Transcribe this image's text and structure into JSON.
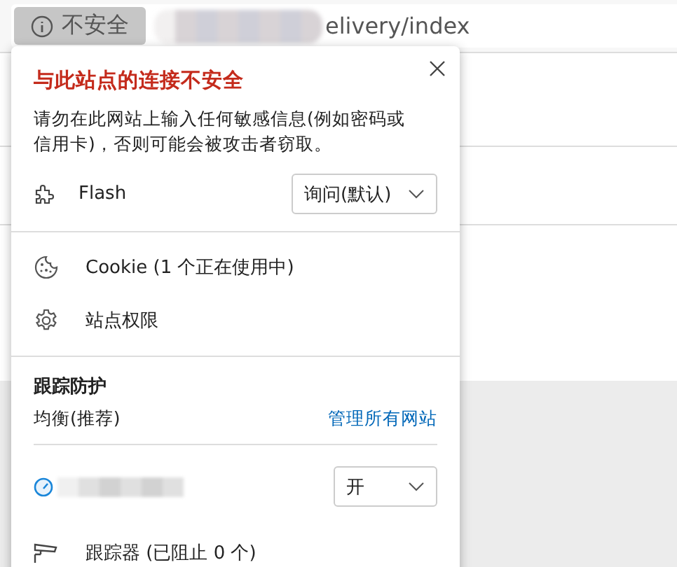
{
  "address_bar": {
    "security_label": "不安全",
    "url": "elivery/index"
  },
  "popup": {
    "title": "与此站点的连接不安全",
    "message": "请勿在此网站上输入任何敏感信息(例如密码或信用卡)，否则可能会被攻击者窃取。",
    "permissions": [
      {
        "label": "Flash",
        "value": "询问(默认)"
      }
    ],
    "links": [
      {
        "kind": "cookie",
        "label": "Cookie (1 个正在使用中)"
      },
      {
        "kind": "settings",
        "label": "站点权限"
      }
    ],
    "tracking": {
      "heading": "跟踪防护",
      "level": "均衡(推荐)",
      "manage_link": "管理所有网站",
      "site_value": "开",
      "trackers": "跟踪器 (已阻止 0 个)"
    }
  }
}
